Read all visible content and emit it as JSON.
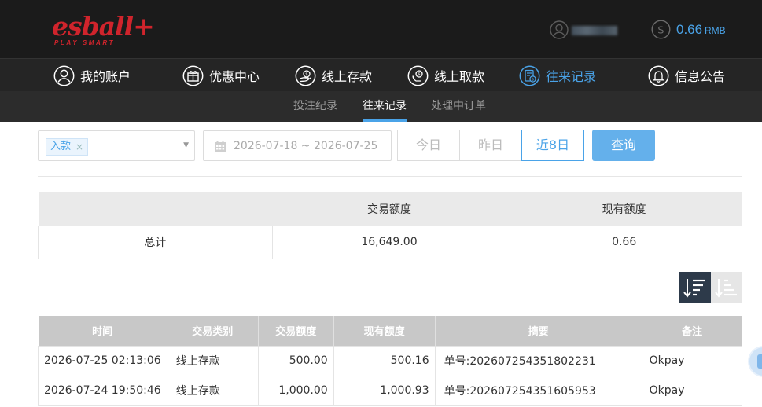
{
  "brand": {
    "logo_text": "esball+",
    "tagline": "PLAY SMART",
    "color": "#d0242c"
  },
  "accent_color": "#4aa3e8",
  "header": {
    "balance_value": "0.66",
    "balance_currency": "RMB"
  },
  "main_nav": [
    {
      "label": "我的账户",
      "icon": "user-icon"
    },
    {
      "label": "优惠中心",
      "icon": "gift-icon"
    },
    {
      "label": "线上存款",
      "icon": "deposit-icon"
    },
    {
      "label": "线上取款",
      "icon": "withdraw-icon"
    },
    {
      "label": "往来记录",
      "icon": "records-icon",
      "active": true
    },
    {
      "label": "信息公告",
      "icon": "bell-icon"
    }
  ],
  "sub_nav": [
    {
      "label": "投注纪录"
    },
    {
      "label": "往来记录",
      "active": true
    },
    {
      "label": "处理中订单"
    }
  ],
  "filters": {
    "type_tag": "入款",
    "date_range": "2026-07-18 ~ 2026-07-25",
    "range_buttons": [
      "今日",
      "昨日",
      "近8日"
    ],
    "active_range": "近8日",
    "query_label": "查询"
  },
  "summary": {
    "headers": [
      "",
      "交易额度",
      "现有额度"
    ],
    "row": [
      "总计",
      "16,649.00",
      "0.66"
    ]
  },
  "records": {
    "headers": [
      "时间",
      "交易类别",
      "交易额度",
      "现有额度",
      "摘要",
      "备注"
    ],
    "rows": [
      [
        "2026-07-25 02:13:06",
        "线上存款",
        "500.00",
        "500.16",
        "单号:202607254351802231",
        "Okpay"
      ],
      [
        "2026-07-24 19:50:46",
        "线上存款",
        "1,000.00",
        "1,000.93",
        "单号:202607254351605953",
        "Okpay"
      ]
    ]
  }
}
